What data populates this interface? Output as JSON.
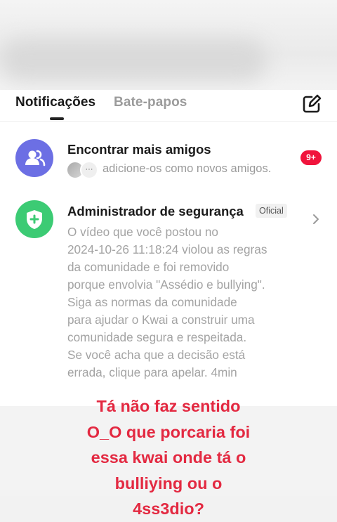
{
  "tabs": [
    {
      "label": "Notificações",
      "active": true
    },
    {
      "label": "Bate-papos",
      "active": false
    }
  ],
  "icons": {
    "edit": "edit-icon",
    "friends": "friends-icon",
    "shield": "shield-plus-icon",
    "chevron": "chevron-right-icon"
  },
  "rows": {
    "friends": {
      "title": "Encontrar mais amigos",
      "subtitle": "adicione-os como novos amigos.",
      "more": "···",
      "badge": "9+"
    },
    "security": {
      "title": "Administrador de segurança",
      "tag": "Oficial",
      "message_lines": [
        "O vídeo que você postou no",
        "2024-10-26 11:18:24 violou as regras",
        "da comunidade e foi removido",
        "porque envolvia \"Assédio e bullying\".",
        "Siga as normas da comunidade",
        "para ajudar o Kwai a construir uma",
        "comunidade segura e respeitada.",
        "Se você acha que a decisão está",
        "errada, clique para apelar.  4min"
      ]
    }
  },
  "overlay_lines": [
    "Tá não faz sentido",
    "O_O que porcaria foi",
    "essa kwai onde tá o",
    "bulliying ou o",
    "4ss3dio?"
  ],
  "colors": {
    "friends_avatar": "#6c6fe4",
    "security_avatar": "#3ccb74",
    "badge": "#f0143c",
    "overlay_text": "#e32941"
  }
}
